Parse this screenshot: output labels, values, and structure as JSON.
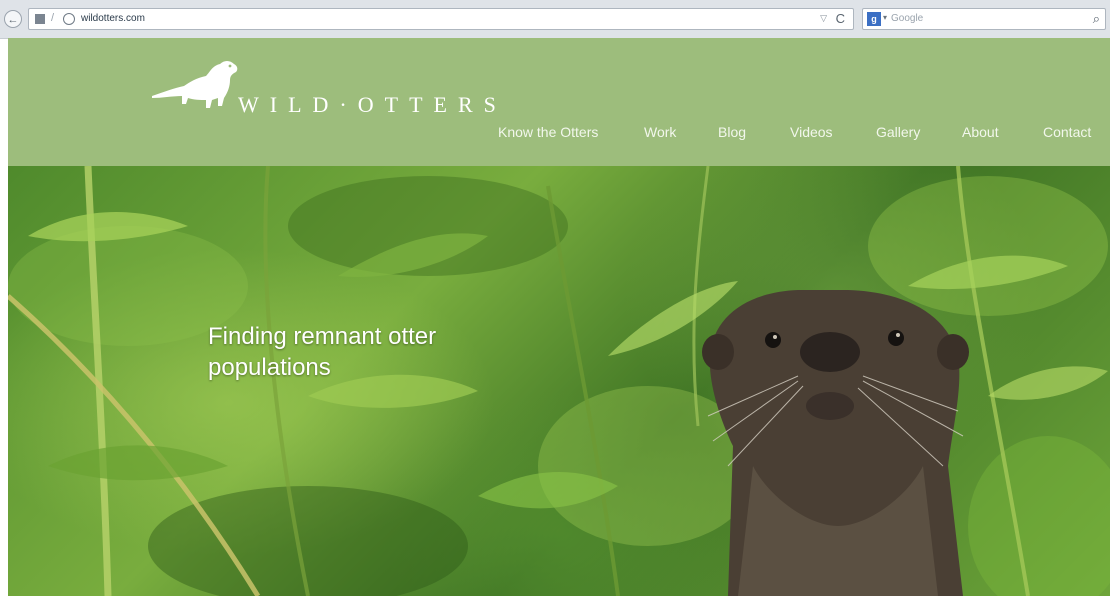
{
  "browser": {
    "url": "wildotters.com",
    "search_placeholder": "Google",
    "back_glyph": "←",
    "reload_glyph": "C",
    "search_glyph": "⌕",
    "engine_letter": "g"
  },
  "site": {
    "brand": "WILD·OTTERS",
    "nav": [
      {
        "label": "Know the Otters"
      },
      {
        "label": "Work"
      },
      {
        "label": "Blog"
      },
      {
        "label": "Videos"
      },
      {
        "label": "Gallery"
      },
      {
        "label": "About"
      },
      {
        "label": "Contact"
      }
    ]
  },
  "hero": {
    "heading": "Finding remnant otter populations"
  },
  "colors": {
    "header_green": "#9dbd7c",
    "text_white": "#ffffff"
  }
}
